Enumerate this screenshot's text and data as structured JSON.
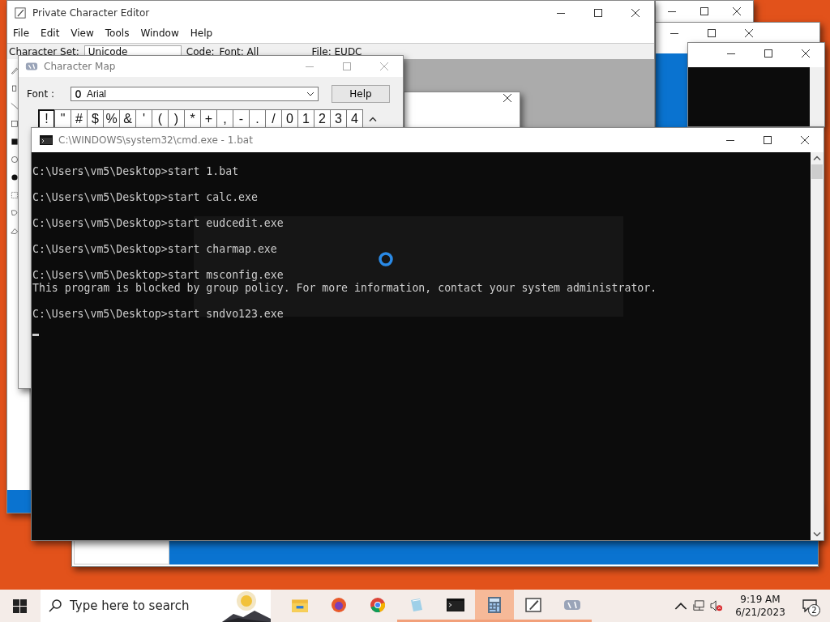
{
  "pce": {
    "title": "Private Character Editor",
    "menu": [
      "File",
      "Edit",
      "View",
      "Tools",
      "Window",
      "Help"
    ],
    "toolbar": {
      "charset_label": "Character Set:",
      "charset_value": "Unicode",
      "code_label": "Code:",
      "font_label": "Font: All",
      "file_label": "File: EUDC"
    }
  },
  "charmap": {
    "title": "Character Map",
    "font_label": "Font :",
    "font_value": "Arial",
    "help": "Help",
    "characters": [
      {
        "char": "!",
        "selected": true
      },
      {
        "char": "\"",
        "selected": false
      },
      {
        "char": "#",
        "selected": false
      },
      {
        "char": "$",
        "selected": false
      },
      {
        "char": "%",
        "selected": false
      },
      {
        "char": "&",
        "selected": false
      },
      {
        "char": "'",
        "selected": false
      },
      {
        "char": "(",
        "selected": false
      },
      {
        "char": ")",
        "selected": false
      },
      {
        "char": "*",
        "selected": false
      },
      {
        "char": "+",
        "selected": false
      },
      {
        "char": ",",
        "selected": false
      },
      {
        "char": "-",
        "selected": false
      },
      {
        "char": ".",
        "selected": false
      },
      {
        "char": "/",
        "selected": false
      },
      {
        "char": "0",
        "selected": false
      },
      {
        "char": "1",
        "selected": false
      },
      {
        "char": "2",
        "selected": false
      },
      {
        "char": "3",
        "selected": false
      },
      {
        "char": "4",
        "selected": false
      }
    ]
  },
  "cmd": {
    "title": "C:\\WINDOWS\\system32\\cmd.exe - 1.bat",
    "blocks": [
      [
        "C:\\Users\\vm5\\Desktop>start 1.bat"
      ],
      [
        "C:\\Users\\vm5\\Desktop>start calc.exe"
      ],
      [
        "C:\\Users\\vm5\\Desktop>start eudcedit.exe"
      ],
      [
        "C:\\Users\\vm5\\Desktop>start charmap.exe"
      ],
      [
        "C:\\Users\\vm5\\Desktop>start msconfig.exe",
        "This program is blocked by group policy. For more information, contact your system administrator."
      ],
      [
        "C:\\Users\\vm5\\Desktop>start sndvo123.exe"
      ]
    ]
  },
  "taskbar": {
    "search": {
      "placeholder": "Type here to search"
    },
    "apps": [
      {
        "kind": "folder",
        "running": false,
        "selected": false
      },
      {
        "kind": "firefox",
        "running": false,
        "selected": false
      },
      {
        "kind": "chrome",
        "running": false,
        "selected": false
      },
      {
        "kind": "notepad",
        "running": true,
        "selected": false
      },
      {
        "kind": "console",
        "running": true,
        "selected": false
      },
      {
        "kind": "calculator",
        "running": true,
        "selected": true
      },
      {
        "kind": "pen",
        "running": true,
        "selected": false
      },
      {
        "kind": "charmap",
        "running": true,
        "selected": false
      }
    ],
    "time": "9:19 AM",
    "date": "6/21/2023",
    "notifications": "2"
  }
}
